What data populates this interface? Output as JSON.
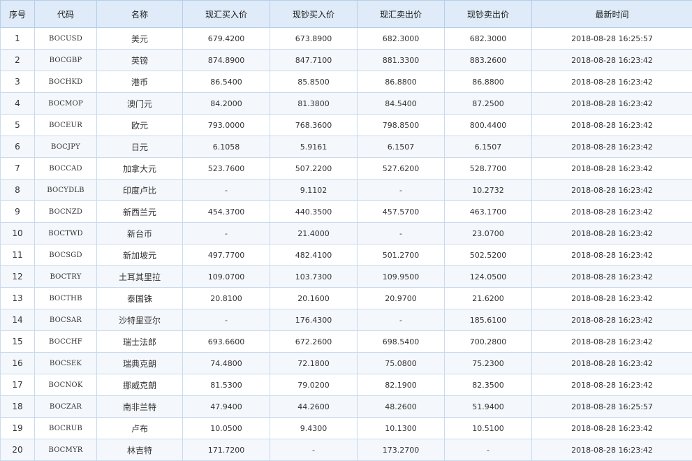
{
  "table": {
    "headers": [
      "序号",
      "代码",
      "名称",
      "现汇买入价",
      "现钞买入价",
      "现汇卖出价",
      "现钞卖出价",
      "最新时间"
    ],
    "rows": [
      [
        "1",
        "BOCUSD",
        "美元",
        "679.4200",
        "673.8900",
        "682.3000",
        "682.3000",
        "2018-08-28 16:25:57"
      ],
      [
        "2",
        "BOCGBP",
        "英镑",
        "874.8900",
        "847.7100",
        "881.3300",
        "883.2600",
        "2018-08-28 16:23:42"
      ],
      [
        "3",
        "BOCHKD",
        "港币",
        "86.5400",
        "85.8500",
        "86.8800",
        "86.8800",
        "2018-08-28 16:23:42"
      ],
      [
        "4",
        "BOCMOP",
        "澳门元",
        "84.2000",
        "81.3800",
        "84.5400",
        "87.2500",
        "2018-08-28 16:23:42"
      ],
      [
        "5",
        "BOCEUR",
        "欧元",
        "793.0000",
        "768.3600",
        "798.8500",
        "800.4400",
        "2018-08-28 16:23:42"
      ],
      [
        "6",
        "BOCJPY",
        "日元",
        "6.1058",
        "5.9161",
        "6.1507",
        "6.1507",
        "2018-08-28 16:23:42"
      ],
      [
        "7",
        "BOCCAD",
        "加拿大元",
        "523.7600",
        "507.2200",
        "527.6200",
        "528.7700",
        "2018-08-28 16:23:42"
      ],
      [
        "8",
        "BOCYDLB",
        "印度卢比",
        "-",
        "9.1102",
        "-",
        "10.2732",
        "2018-08-28 16:23:42"
      ],
      [
        "9",
        "BOCNZD",
        "新西兰元",
        "454.3700",
        "440.3500",
        "457.5700",
        "463.1700",
        "2018-08-28 16:23:42"
      ],
      [
        "10",
        "BOCTWD",
        "新台币",
        "-",
        "21.4000",
        "-",
        "23.0700",
        "2018-08-28 16:23:42"
      ],
      [
        "11",
        "BOCSGD",
        "新加坡元",
        "497.7700",
        "482.4100",
        "501.2700",
        "502.5200",
        "2018-08-28 16:23:42"
      ],
      [
        "12",
        "BOCTRY",
        "土耳其里拉",
        "109.0700",
        "103.7300",
        "109.9500",
        "124.0500",
        "2018-08-28 16:23:42"
      ],
      [
        "13",
        "BOCTHB",
        "泰国铢",
        "20.8100",
        "20.1600",
        "20.9700",
        "21.6200",
        "2018-08-28 16:23:42"
      ],
      [
        "14",
        "BOCSAR",
        "沙特里亚尔",
        "-",
        "176.4300",
        "-",
        "185.6100",
        "2018-08-28 16:23:42"
      ],
      [
        "15",
        "BOCCHF",
        "瑞士法郎",
        "693.6600",
        "672.2600",
        "698.5400",
        "700.2800",
        "2018-08-28 16:23:42"
      ],
      [
        "16",
        "BOCSEK",
        "瑞典克朗",
        "74.4800",
        "72.1800",
        "75.0800",
        "75.2300",
        "2018-08-28 16:23:42"
      ],
      [
        "17",
        "BOCNOK",
        "挪威克朗",
        "81.5300",
        "79.0200",
        "82.1900",
        "82.3500",
        "2018-08-28 16:23:42"
      ],
      [
        "18",
        "BOCZAR",
        "南非兰特",
        "47.9400",
        "44.2600",
        "48.2600",
        "51.9400",
        "2018-08-28 16:25:57"
      ],
      [
        "19",
        "BOCRUB",
        "卢布",
        "10.0500",
        "9.4300",
        "10.1300",
        "10.5100",
        "2018-08-28 16:23:42"
      ],
      [
        "20",
        "BOCMYR",
        "林吉特",
        "171.7200",
        "-",
        "173.2700",
        "-",
        "2018-08-28 16:23:42"
      ]
    ]
  },
  "colors": {
    "header_bg": "#dfebf8",
    "border": "#c9daf0",
    "stripe": "#f4f7fb"
  }
}
